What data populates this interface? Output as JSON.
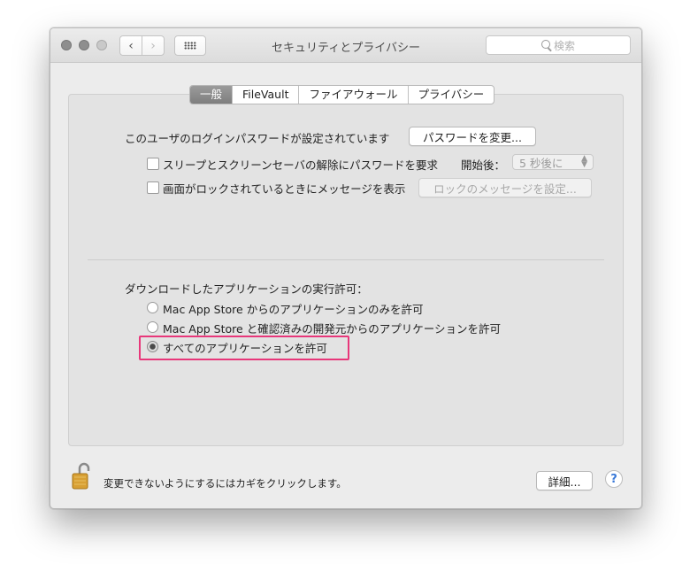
{
  "window": {
    "title": "セキュリティとプライバシー",
    "search_placeholder": "検索"
  },
  "tabs": [
    "一般",
    "FileVault",
    "ファイアウォール",
    "プライバシー"
  ],
  "active_tab": 0,
  "login": {
    "message": "このユーザのログインパスワードが設定されています",
    "change_password_button": "パスワードを変更..."
  },
  "options": {
    "require_password_label": "スリープとスクリーンセーバの解除にパスワードを要求",
    "require_password_checked": false,
    "after_label": "開始後：",
    "after_value": "5 秒後に",
    "show_message_label": "画面がロックされているときにメッセージを表示",
    "show_message_checked": false,
    "set_message_button": "ロックのメッセージを設定..."
  },
  "downloads": {
    "heading": "ダウンロードしたアプリケーションの実行許可：",
    "choices": [
      "Mac App Store からのアプリケーションのみを許可",
      "Mac App Store と確認済みの開発元からのアプリケーションを許可",
      "すべてのアプリケーションを許可"
    ],
    "selected": 2
  },
  "footer": {
    "lock_message": "変更できないようにするにはカギをクリックします。",
    "advanced_button": "詳細...",
    "help": "?"
  },
  "colors": {
    "highlight": "#e8377a",
    "help_accent": "#3b7ad8",
    "lock_gold": "#d8a034"
  }
}
